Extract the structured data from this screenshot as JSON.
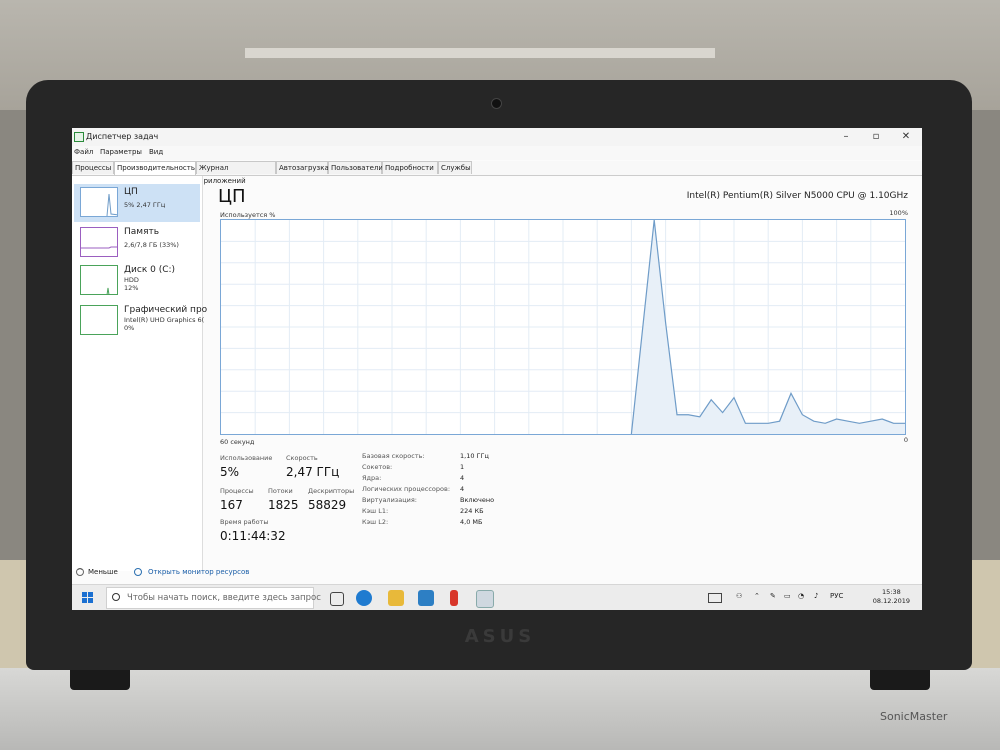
{
  "window": {
    "title": "Диспетчер задач",
    "controls": {
      "minimize": "–",
      "maximize": "▫",
      "close": "✕"
    }
  },
  "menu": [
    "Файл",
    "Параметры",
    "Вид"
  ],
  "tabs": [
    "Процессы",
    "Производительность",
    "Журнал приложений",
    "Автозагрузка",
    "Пользователи",
    "Подробности",
    "Службы"
  ],
  "active_tab": "Производительность",
  "sidebar": {
    "items": [
      {
        "name": "ЦП",
        "line1": "5% 2,47 ГГц",
        "line2": ""
      },
      {
        "name": "Память",
        "line1": "2,6/7,8 ГБ (33%)",
        "line2": ""
      },
      {
        "name": "Диск 0 (C:)",
        "line1": "HDD",
        "line2": "12%"
      },
      {
        "name": "Графический про",
        "line1": "Intel(R) UHD Graphics 6(",
        "line2": "0%"
      }
    ]
  },
  "main": {
    "title": "ЦП",
    "cpu_model": "Intel(R) Pentium(R) Silver N5000 CPU @ 1.10GHz",
    "y_label": "Используется %",
    "y_max": "100%",
    "x_label": "60 секунд",
    "x_min": "0"
  },
  "chart_data": {
    "type": "area",
    "title": "",
    "xlabel": "60 секунд",
    "ylabel": "Используется %",
    "xlim": [
      60,
      0
    ],
    "ylim": [
      0,
      100
    ],
    "grid": true,
    "x": [
      60,
      59,
      58,
      57,
      56,
      55,
      54,
      53,
      52,
      51,
      50,
      49,
      48,
      47,
      46,
      45,
      44,
      43,
      42,
      41,
      40,
      39,
      38,
      37,
      36,
      35,
      34,
      33,
      32,
      31,
      30,
      29,
      28,
      27,
      26,
      25,
      24,
      23,
      22,
      21,
      20,
      19,
      18,
      17,
      16,
      15,
      14,
      13,
      12,
      11,
      10,
      9,
      8,
      7,
      6,
      5,
      4,
      3,
      2,
      1,
      0
    ],
    "values": [
      null,
      null,
      null,
      null,
      null,
      null,
      null,
      null,
      null,
      null,
      null,
      null,
      null,
      null,
      null,
      null,
      null,
      null,
      null,
      null,
      null,
      null,
      null,
      null,
      null,
      null,
      null,
      null,
      null,
      null,
      null,
      null,
      null,
      null,
      null,
      null,
      0,
      50,
      100,
      52,
      9,
      9,
      8,
      16,
      10,
      17,
      5,
      5,
      5,
      6,
      19,
      9,
      6,
      5,
      7,
      6,
      5,
      6,
      7,
      5,
      5
    ]
  },
  "stats": {
    "usage_label": "Использование",
    "usage_value": "5%",
    "speed_label": "Скорость",
    "speed_value": "2,47 ГГц",
    "processes_label": "Процессы",
    "processes_value": "167",
    "threads_label": "Потоки",
    "threads_value": "1825",
    "handles_label": "Дескрипторы",
    "handles_value": "58829",
    "uptime_label": "Время работы",
    "uptime_value": "0:11:44:32"
  },
  "info": [
    {
      "label": "Базовая скорость:",
      "value": "1,10 ГГц"
    },
    {
      "label": "Сокетов:",
      "value": "1"
    },
    {
      "label": "Ядра:",
      "value": "4"
    },
    {
      "label": "Логических процессоров:",
      "value": "4"
    },
    {
      "label": "Виртуализация:",
      "value": "Включено"
    },
    {
      "label": "Кэш L1:",
      "value": "224 КБ"
    },
    {
      "label": "Кэш L2:",
      "value": "4,0 МБ"
    }
  ],
  "footer": {
    "less": "Меньше",
    "monitor": "Открыть монитор ресурсов"
  },
  "taskbar": {
    "search_placeholder": "Чтобы начать поиск, введите здесь запрос",
    "lang": "РУС",
    "time": "15:38",
    "date": "08.12.2019"
  },
  "laptop": {
    "brand": "ASUS",
    "model_badge": "SonicMaster"
  },
  "colors": {
    "accent": "#1a6fd1",
    "graph_line": "#6f9cc8",
    "graph_fill": "#e8f0f8",
    "selected": "#cde1f5"
  }
}
